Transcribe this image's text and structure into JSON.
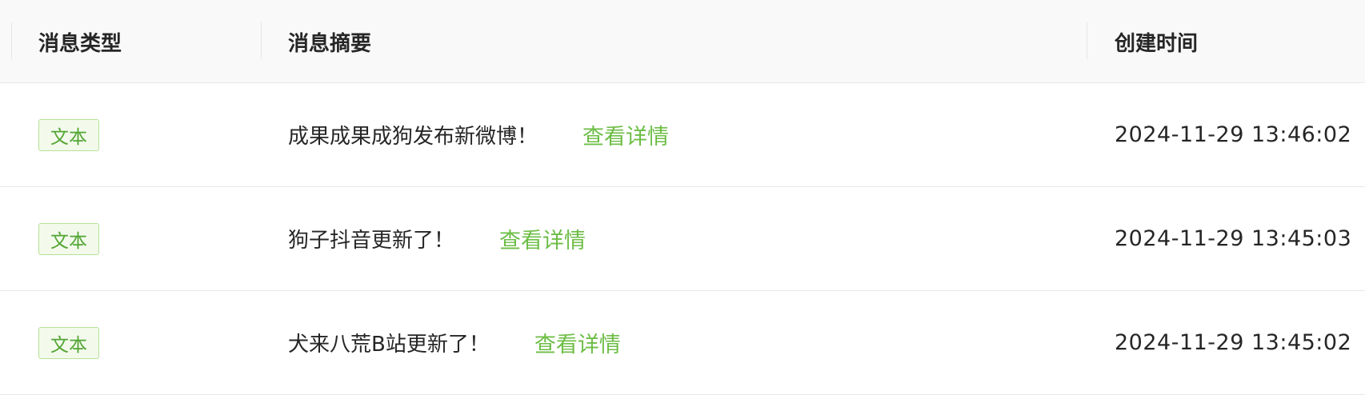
{
  "table": {
    "headers": {
      "type": "消息类型",
      "summary": "消息摘要",
      "created": "创建时间"
    },
    "rows": [
      {
        "tag": "文本",
        "summary": "成果成果成狗发布新微博！",
        "link": "查看详情",
        "time": "2024-11-29 13:46:02"
      },
      {
        "tag": "文本",
        "summary": "狗子抖音更新了！",
        "link": "查看详情",
        "time": "2024-11-29 13:45:03"
      },
      {
        "tag": "文本",
        "summary": "犬来八荒B站更新了！",
        "link": "查看详情",
        "time": "2024-11-29 13:45:02"
      }
    ]
  },
  "colors": {
    "accent_green": "#6cbd45",
    "tag_border": "#b7e196",
    "header_bg": "#f9f9f9"
  }
}
